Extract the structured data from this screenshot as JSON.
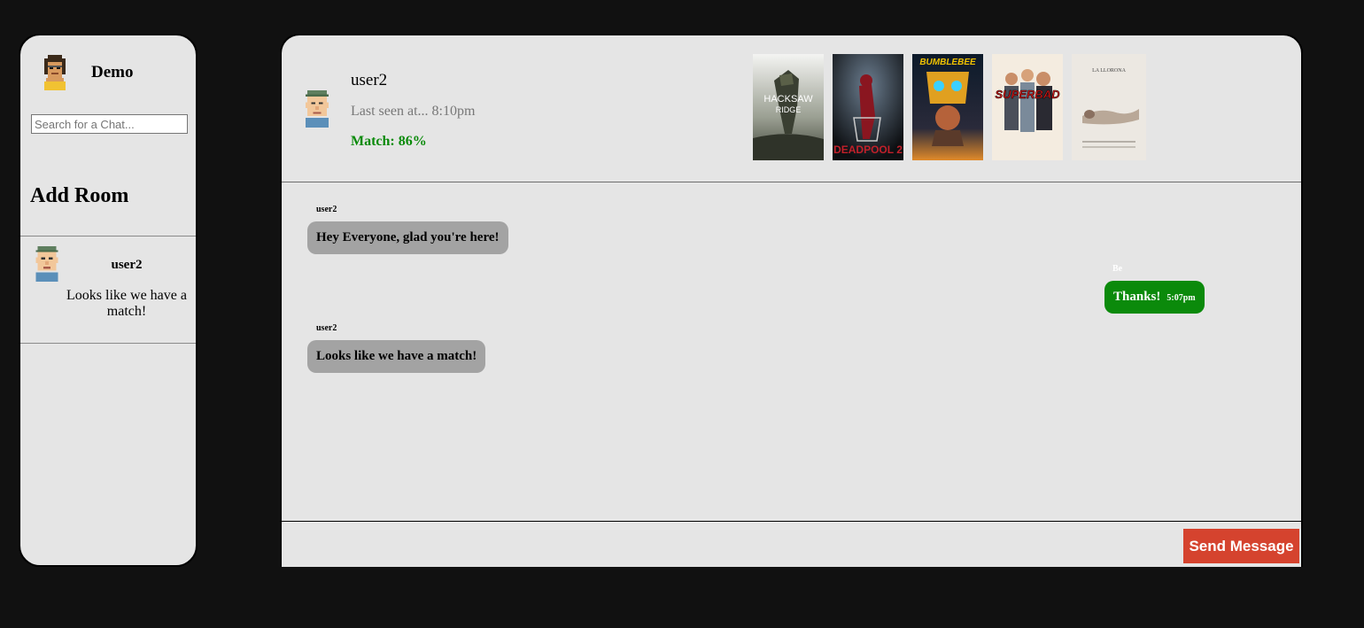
{
  "sidebar": {
    "username": "Demo",
    "search_placeholder": "Search for a Chat...",
    "add_room_label": "Add Room",
    "chats": [
      {
        "name": "user2",
        "last_message": "Looks like we have a match!"
      }
    ]
  },
  "header": {
    "name": "user2",
    "last_seen": "Last seen at... 8:10pm",
    "match": "Match: 86%"
  },
  "posters": [
    {
      "title_line1": "HACKSAW",
      "title_line2": "RIDGE"
    },
    {
      "title": "DEADPOOL 2"
    },
    {
      "title": "BUMBLEBEE"
    },
    {
      "title": "SUPERBAD"
    },
    {
      "title": "LA LLORONA"
    }
  ],
  "messages": [
    {
      "sender": "user2",
      "text": "Hey Everyone, glad you're here!"
    },
    {
      "sender": "Be",
      "text": "Thanks!",
      "time": "5:07pm"
    },
    {
      "sender": "user2",
      "text": "Looks like we have a match!"
    }
  ],
  "composer": {
    "input_value": "",
    "send_label": "Send Message"
  },
  "colors": {
    "background": "#111111",
    "panel": "#e5e5e5",
    "match_green": "#0a8a0a",
    "my_bubble": "#0b8a0b",
    "other_bubble": "#a3a3a3",
    "send_button": "#d5432e"
  }
}
